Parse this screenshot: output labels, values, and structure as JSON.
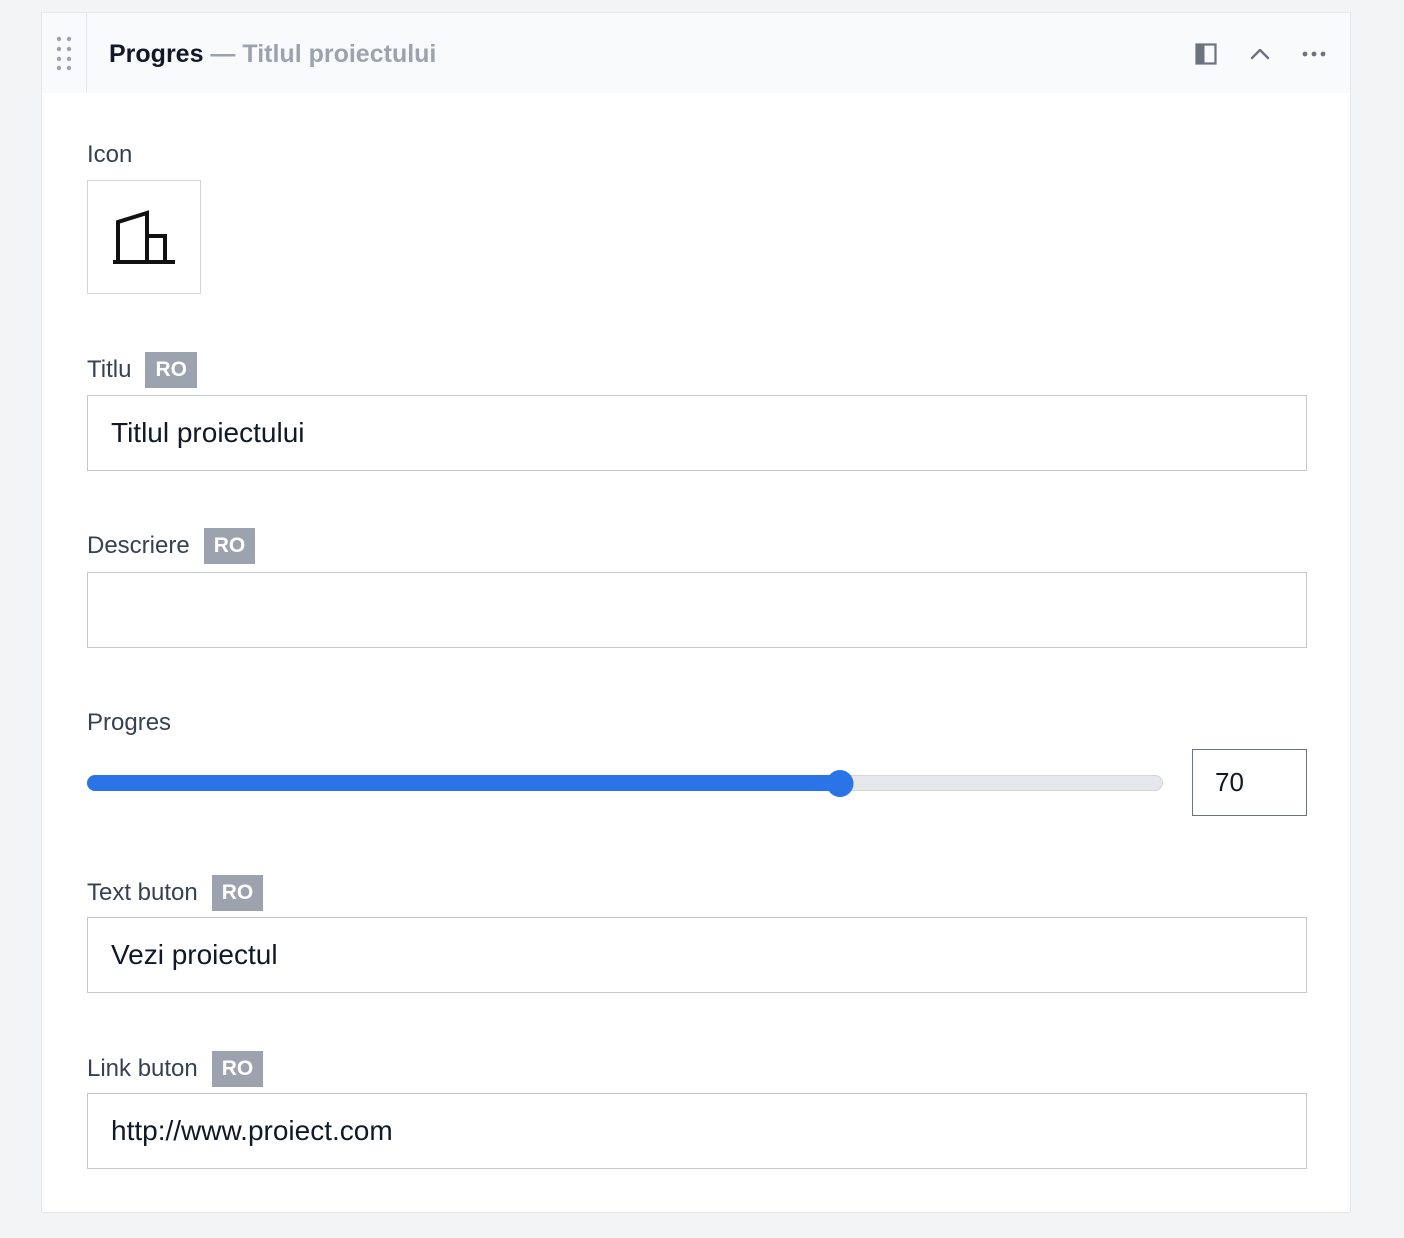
{
  "header": {
    "title": "Progres",
    "separator": " — ",
    "subtitle": "Titlul proiectului",
    "actions": [
      "layout-toggle-icon",
      "chevron-up-icon",
      "more-horizontal-icon"
    ]
  },
  "fields": {
    "icon": {
      "label": "Icon",
      "value_icon": "building-icon"
    },
    "title": {
      "label": "Titlu",
      "badge": "RO",
      "value": "Titlul proiectului"
    },
    "description": {
      "label": "Descriere",
      "badge": "RO",
      "value": ""
    },
    "progress": {
      "label": "Progres",
      "value": "70",
      "percent": 70,
      "max": 100
    },
    "button_text": {
      "label": "Text buton",
      "badge": "RO",
      "value": "Vezi proiectul"
    },
    "button_link": {
      "label": "Link buton",
      "badge": "RO",
      "value": "http://www.proiect.com"
    }
  },
  "colors": {
    "accent": "#2b74e8",
    "badge": "#9ca3af",
    "header_bg": "#f9fafb",
    "page_bg": "#f3f4f6"
  }
}
